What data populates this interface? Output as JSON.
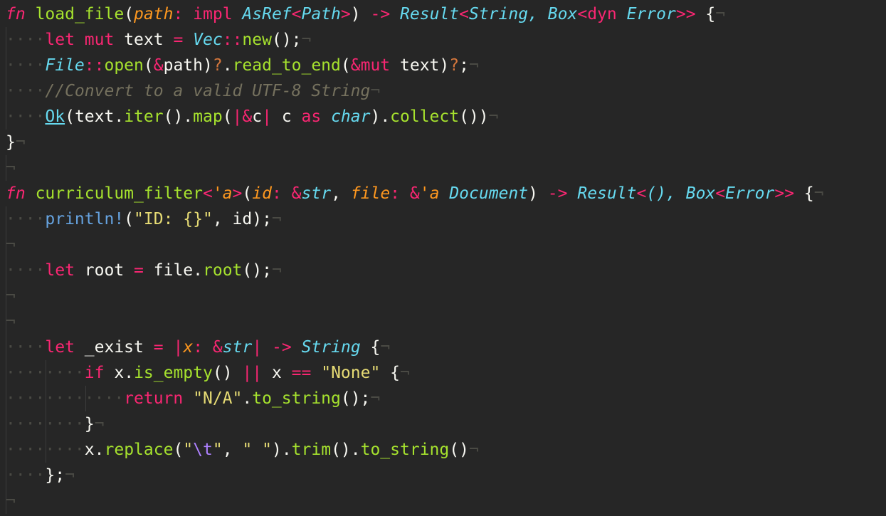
{
  "editor": {
    "language": "Rust",
    "background": "#262626",
    "font_size_px": 23,
    "line_height_px": 36,
    "eol_marker": "¬",
    "indent_dot": "·",
    "palette": {
      "keyword": "#f92672",
      "function": "#a6e22e",
      "type": "#66d9ef",
      "parameter": "#fd971f",
      "plain": "#f8f8f2",
      "string": "#e6db74",
      "escape": "#ae81ff",
      "comment": "#75715e",
      "macro": "#66a3e0",
      "question_operator": "#d4763c",
      "invisible": "#4a4a44",
      "indent_guide": "#3b3b3b"
    }
  },
  "code": {
    "line_01": "fn load_file(path: impl AsRef<Path>) -> Result<String, Box<dyn Error>> {",
    "line_02": "    let mut text = Vec::new();",
    "line_03": "    File::open(&path)?.read_to_end(&mut text)?;",
    "line_04": "    //Convert to a valid UTF-8 String",
    "line_05": "    Ok(text.iter().map(|&c| c as char).collect())",
    "line_06": "}",
    "line_07": "",
    "line_08": "fn curriculum_filter<'a>(id: &str, file: &'a Document) -> Result<(), Box<Error>> {",
    "line_09": "    println!(\"ID: {}\", id);",
    "line_10": "",
    "line_11": "    let root = file.root();",
    "line_12": "",
    "line_13": "",
    "line_14": "    let _exist = |x: &str| -> String {",
    "line_15": "        if x.is_empty() || x == \"None\" {",
    "line_16": "            return \"N/A\".to_string();",
    "line_17": "        }",
    "line_18": "        x.replace(\"\\t\", \" \").trim().to_string()",
    "line_19": "    };",
    "line_20": ""
  },
  "tokens": {
    "fn": "fn",
    "load_file": "load_file",
    "path": "path",
    "impl": "impl",
    "as_ref": "AsRef",
    "path_type": "Path",
    "arrow": "->",
    "result": "Result",
    "string_type": "String",
    "box_type": "Box",
    "dyn": "dyn",
    "error_type": "Error",
    "let": "let",
    "mut": "mut",
    "text": "text",
    "vec": "Vec",
    "new": "new",
    "file_type": "File",
    "open": "open",
    "read_to_end": "read_to_end",
    "comment_utf8": "//Convert to a valid UTF-8 String",
    "ok": "Ok",
    "iter": "iter",
    "map": "map",
    "as_kw": "as",
    "char_type": "char",
    "collect": "collect",
    "curriculum_filter": "curriculum_filter",
    "lifetime_a": "'a",
    "id": "id",
    "str_type": "str",
    "file_param": "file",
    "document_type": "Document",
    "println": "println!",
    "id_format_string": "\"ID: {}\"",
    "root": "root",
    "exist": "_exist",
    "x": "x",
    "if": "if",
    "is_empty": "is_empty",
    "or_or": "||",
    "eq_eq": "==",
    "none_string": "\"None\"",
    "return": "return",
    "na_string": "\"N/A\"",
    "to_string": "to_string",
    "replace": "replace",
    "tab_escape": "\\t",
    "space_string": "\" \"",
    "trim": "trim"
  }
}
